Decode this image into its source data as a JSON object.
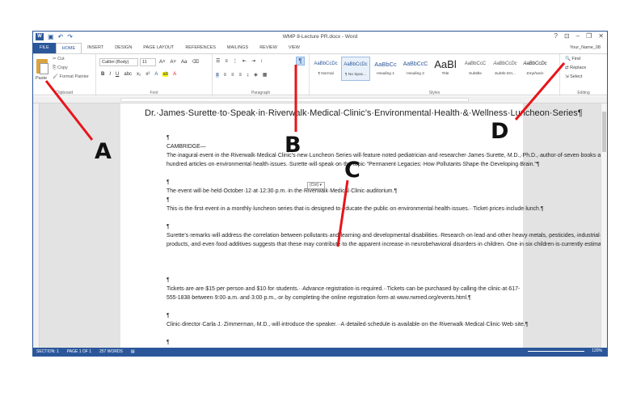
{
  "window": {
    "title": "WMP 8-Lecture PR.docx - Word",
    "user": "Your_Name_08",
    "controls": [
      "?",
      "⊡",
      "–",
      "❐",
      "✕"
    ]
  },
  "tabs": [
    "FILE",
    "HOME",
    "INSERT",
    "DESIGN",
    "PAGE LAYOUT",
    "REFERENCES",
    "MAILINGS",
    "REVIEW",
    "VIEW"
  ],
  "ribbon": {
    "clipboard": {
      "paste": "Paste",
      "cut": "Cut",
      "copy": "Copy",
      "format_painter": "Format Painter",
      "label": "Clipboard"
    },
    "font": {
      "name": "Calibri (Body)",
      "size": "11",
      "label": "Font"
    },
    "paragraph": {
      "label": "Paragraph",
      "show_marks": "¶"
    },
    "styles": {
      "label": "Styles",
      "items": [
        {
          "preview": "AaBbCcDc",
          "name": "¶ Normal"
        },
        {
          "preview": "AaBbCcDc",
          "name": "¶ No Spac..."
        },
        {
          "preview": "AaBbCc",
          "name": "Heading 1"
        },
        {
          "preview": "AaBbCcC",
          "name": "Heading 2"
        },
        {
          "preview": "AaBl",
          "name": "Title"
        },
        {
          "preview": "AaBbCcC",
          "name": "Subtitle"
        },
        {
          "preview": "AaBbCcDc",
          "name": "Subtle Em..."
        },
        {
          "preview": "AaBbCcDc",
          "name": "Emphasis"
        }
      ]
    },
    "editing": {
      "find": "Find",
      "replace": "Replace",
      "select": "Select",
      "label": "Editing"
    }
  },
  "document": {
    "title": "Dr.·James·Surette·to·Speak·in·Riverwalk·Medical·Clinic’s·Environmental·Health·&·Wellness·Luncheon·Series¶",
    "paragraphs": [
      "¶",
      "CAMBRIDGE—The·inagural·event·in·the·Riverwalk·Medical·Clinic’s·new·Luncheon·Series·will·feature·noted·pediatrician·and·researcher·James·Surette,·M.D.,·Ph.D.,·author·of·seven·books·and·more·than·two-hundred·articles·on·environmental·health·issues.·Surette·will·speak·on·the·topic·“Permanent·Legacies:·How·Pollutants·Shape·the·Developing·Brain.”¶",
      "¶",
      "The·event·will·be·held·October·12·at·12:30·p.m.·in·the·Riverwalk·Medical·Clinic·auditorium.¶",
      "¶",
      "This·is·the·first·event·in·a·monthly·luncheon·series·that·is·designed·to·educate·the·public·on·environmental·health·issues.··Ticket·prices·include·lunch.¶",
      "¶",
      "Surette’s·remarks·will·address·the·correlation·between·pollutants·and·learning·and·developmental·disabilities.·Research·on·lead·and·other·heavy·metals,·pesticides,·industrial·by-products,·and·even·food·additives·suggests·that·these·may·contribute·to·the·apparent·increase·in·neurobehavioral·disorders·in·children.·One·in·six·children·is·currently·estimated·to·have·some·kind·of·learning·or·developmental·disability.¶",
      "¶",
      "Tickets·are·are·$15·per·person·and·$10·for·students.··Advance·registration·is·required.··Tickets·can·be·purchased·by·calling·the·clinic·at·617-555-1838·between·9:00·a.m.·and·3:00·p.m.,·or·by·completing·the·online·registration·form·at·www.rwmed.org/events.html.¶",
      "¶",
      "Clinic·director·Carla·J.·Zimmerman,·M.D.,·will·introduce·the·speaker.··A·detailed·schedule·is·available·on·the·Riverwalk·Medical·Clinic·Web·site.¶",
      "¶"
    ],
    "paste_options": "(Ctrl) ▾"
  },
  "status_bar": {
    "section": "SECTION: 1",
    "page": "PAGE 1 OF 1",
    "words": "257 WORDS",
    "zoom": "120%"
  },
  "annotations": [
    "A",
    "B",
    "C",
    "D"
  ],
  "colors": {
    "brand": "#2b579a",
    "annotation_line": "#e8141b"
  }
}
